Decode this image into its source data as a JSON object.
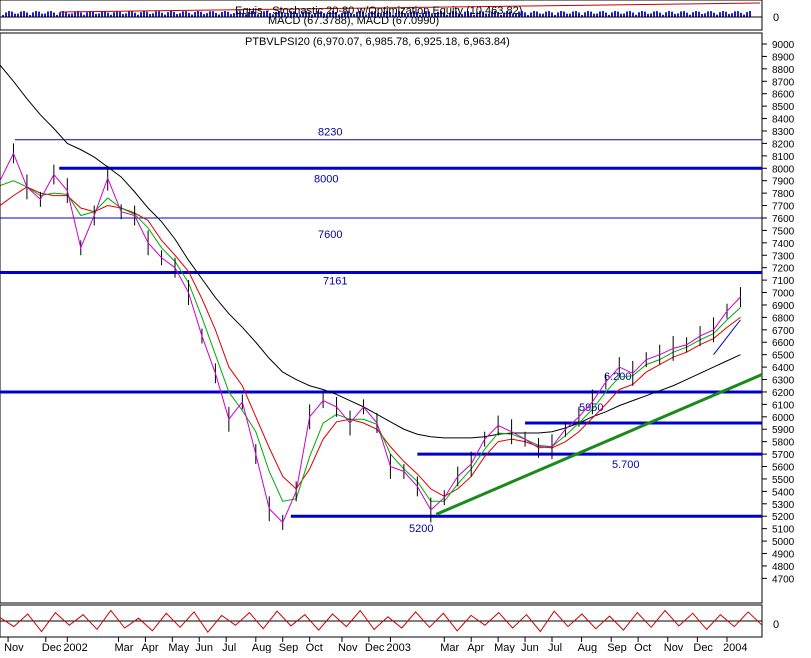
{
  "chart_data": {
    "type": "line",
    "top_panel": {
      "title": "Equis - Stochastic 20-80 w/Optimization Equity (10,463.82)",
      "subtitle": "MACD (67.3788), MACD (67.0990)",
      "zero_label": "0"
    },
    "main_panel": {
      "title": "PTBVLPSI20 (6,970.07, 6,985.78, 6,925.18, 6,963.84)",
      "ylim": [
        4500,
        9100
      ],
      "y_ticks": [
        4700,
        4800,
        4900,
        5000,
        5100,
        5200,
        5300,
        5400,
        5500,
        5600,
        5700,
        5800,
        5900,
        6000,
        6100,
        6200,
        6300,
        6400,
        6500,
        6600,
        6700,
        6800,
        6900,
        7000,
        7100,
        7200,
        7300,
        7400,
        7500,
        7600,
        7700,
        7800,
        7900,
        8000,
        8100,
        8200,
        8300,
        8400,
        8500,
        8600,
        8700,
        8800,
        8900,
        9000
      ],
      "horizontal_levels": [
        {
          "value": 8230,
          "label": "8230",
          "weight": "thin",
          "x_start": 0.55
        },
        {
          "value": 8000,
          "label": "8000",
          "weight": "thick",
          "x_start": 2.2
        },
        {
          "value": 7600,
          "label": "7600",
          "weight": "thin",
          "x_start": 0
        },
        {
          "value": 7161,
          "label": "7161",
          "weight": "thick",
          "x_start": 0
        },
        {
          "value": 6200,
          "label": "6.200",
          "weight": "thick",
          "x_start": 0
        },
        {
          "value": 5950,
          "label": "5950",
          "weight": "thick",
          "x_start": 19.5
        },
        {
          "value": 5700,
          "label": "5.700",
          "weight": "thick",
          "x_start": 15.5
        },
        {
          "value": 5200,
          "label": "5200",
          "weight": "thick",
          "x_start": 10.8
        }
      ],
      "trendlines": [
        {
          "x": [
            16.2,
            28.3
          ],
          "y": [
            5215,
            6340
          ],
          "color": "#1a8a1a",
          "width": 3
        }
      ],
      "price_series": {
        "name": "PTBVLPSI20",
        "x": [
          0,
          0.5,
          1,
          1.5,
          2,
          2.5,
          3,
          3.5,
          4,
          4.5,
          5,
          5.5,
          6,
          6.5,
          7,
          7.5,
          8,
          8.5,
          9,
          9.5,
          10,
          10.5,
          11,
          11.5,
          12,
          12.5,
          13,
          13.5,
          14,
          14.5,
          15,
          15.5,
          16,
          16.5,
          17,
          17.5,
          18,
          18.5,
          19,
          19.5,
          20,
          20.5,
          21,
          21.5,
          22,
          22.5,
          23,
          23.5,
          24,
          24.5,
          25,
          25.5,
          26,
          26.5,
          27,
          27.5
        ],
        "y": [
          7900,
          8120,
          7850,
          7750,
          7950,
          7820,
          7360,
          7620,
          7920,
          7650,
          7620,
          7400,
          7280,
          7200,
          7000,
          6650,
          6350,
          5980,
          6120,
          5700,
          5260,
          5150,
          5400,
          6000,
          6130,
          6080,
          5950,
          6080,
          5950,
          5600,
          5560,
          5440,
          5250,
          5350,
          5520,
          5620,
          5820,
          5930,
          5880,
          5820,
          5750,
          5760,
          5900,
          6000,
          6120,
          6280,
          6400,
          6350,
          6460,
          6500,
          6550,
          6580,
          6650,
          6700,
          6850,
          6964
        ]
      },
      "ma_short": {
        "name": "green",
        "y": [
          7860,
          7900,
          7850,
          7780,
          7800,
          7790,
          7620,
          7650,
          7760,
          7680,
          7630,
          7520,
          7360,
          7250,
          7080,
          6800,
          6500,
          6200,
          6050,
          5880,
          5560,
          5320,
          5340,
          5680,
          5950,
          6020,
          5980,
          5980,
          5940,
          5700,
          5580,
          5480,
          5320,
          5320,
          5460,
          5580,
          5740,
          5870,
          5860,
          5820,
          5770,
          5760,
          5850,
          5950,
          6060,
          6200,
          6320,
          6330,
          6420,
          6460,
          6520,
          6560,
          6620,
          6670,
          6780,
          6880
        ]
      },
      "ma_medium": {
        "name": "red",
        "y": [
          7700,
          7780,
          7850,
          7800,
          7780,
          7780,
          7680,
          7650,
          7700,
          7680,
          7640,
          7580,
          7420,
          7300,
          7170,
          6950,
          6700,
          6400,
          6250,
          6000,
          5750,
          5520,
          5420,
          5580,
          5820,
          5960,
          5980,
          5950,
          5900,
          5760,
          5640,
          5540,
          5420,
          5360,
          5420,
          5520,
          5680,
          5800,
          5820,
          5800,
          5760,
          5750,
          5800,
          5880,
          5990,
          6100,
          6220,
          6260,
          6360,
          6420,
          6480,
          6520,
          6580,
          6630,
          6720,
          6800
        ]
      },
      "ma_long": {
        "name": "black",
        "y": [
          8830,
          8700,
          8560,
          8430,
          8320,
          8200,
          8150,
          8090,
          8010,
          7930,
          7810,
          7680,
          7570,
          7430,
          7260,
          7110,
          6960,
          6830,
          6720,
          6600,
          6470,
          6360,
          6300,
          6250,
          6220,
          6180,
          6130,
          6080,
          6020,
          5960,
          5900,
          5860,
          5840,
          5830,
          5830,
          5830,
          5840,
          5860,
          5870,
          5870,
          5870,
          5880,
          5910,
          5950,
          6000,
          6040,
          6090,
          6130,
          6170,
          6210,
          6250,
          6300,
          6350,
          6400,
          6450,
          6500
        ]
      },
      "upper_channel": {
        "name": "blue-upper",
        "y": [
          6500,
          6640,
          6780
        ]
      },
      "upper_channel_x": [
        26.5,
        27,
        27.5
      ]
    },
    "oscillator_panel": {
      "zero_label": "0",
      "values": [
        5,
        -8,
        10,
        -15,
        12,
        -6,
        9,
        -12,
        15,
        -10,
        4,
        -14,
        11,
        -9,
        13,
        -16,
        8,
        -6,
        12,
        -11,
        14,
        -7,
        9,
        -13,
        10,
        -8,
        15,
        -12,
        6,
        -10,
        13,
        -9,
        11,
        -14,
        8,
        -6,
        12,
        -10,
        9,
        -15,
        14,
        -8,
        10,
        -11,
        7,
        -13,
        12,
        -9,
        15,
        -7,
        11,
        -12,
        9,
        -8,
        13,
        -6
      ]
    },
    "x_axis": {
      "labels": [
        "Nov",
        "Dec",
        "2002",
        "Mar",
        "Apr",
        "May",
        "Jun",
        "Jul",
        "Aug",
        "Sep",
        "Oct",
        "Nov",
        "Dec",
        "2003",
        "Mar",
        "Apr",
        "May",
        "Jun",
        "Jul",
        "Aug",
        "Sep",
        "Oct",
        "Nov",
        "Dec",
        "2004"
      ],
      "positions": [
        0.3,
        1.7,
        2.5,
        4.4,
        5.4,
        6.4,
        7.4,
        8.4,
        9.5,
        10.5,
        11.5,
        12.7,
        13.7,
        14.5,
        16.5,
        17.5,
        18.5,
        19.5,
        20.5,
        21.6,
        22.7,
        23.7,
        24.8,
        25.9,
        27.0
      ]
    }
  }
}
